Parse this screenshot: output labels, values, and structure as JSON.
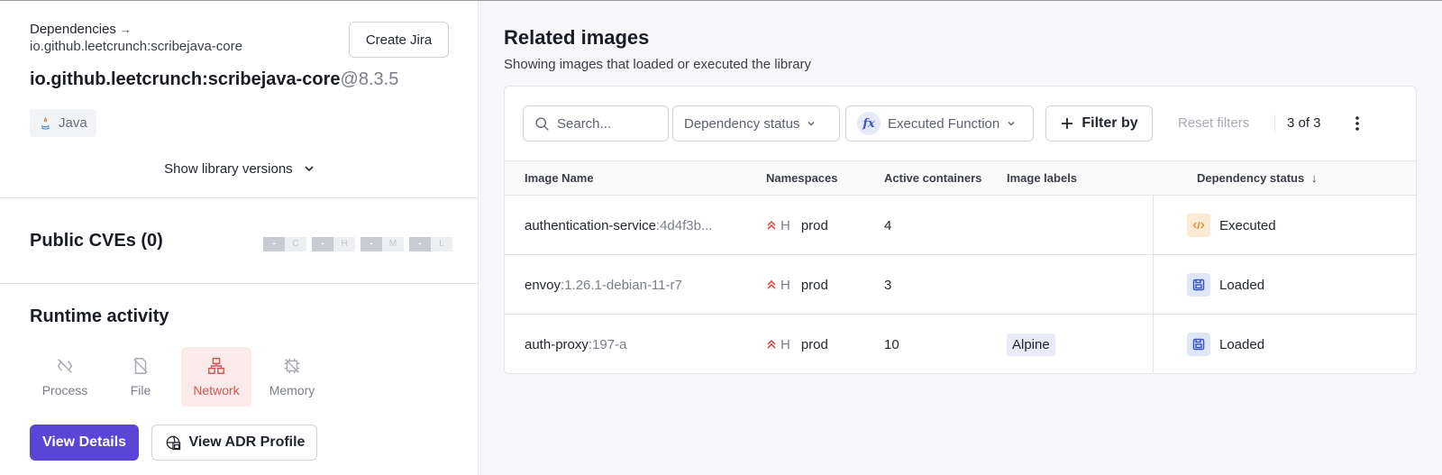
{
  "left": {
    "breadcrumb": "Dependencies",
    "breadcrumb_arrow": "→",
    "breadcrumb_sub": "io.github.leetcrunch:scribejava-core",
    "create_jira_label": "Create Jira",
    "library_name": "io.github.leetcrunch:scribejava-core",
    "library_version": "@8.3.5",
    "language": "Java",
    "show_versions_label": "Show library versions",
    "cves_title": "Public CVEs (0)",
    "severity": [
      {
        "count": "-",
        "letter": "C"
      },
      {
        "count": "-",
        "letter": "H"
      },
      {
        "count": "-",
        "letter": "M"
      },
      {
        "count": "-",
        "letter": "L"
      }
    ],
    "runtime_title": "Runtime activity",
    "runtime_tabs": [
      "Process",
      "File",
      "Network",
      "Memory"
    ],
    "active_runtime_tab": "Network",
    "view_details_label": "View Details",
    "view_adr_label": "View ADR Profile"
  },
  "right": {
    "title": "Related images",
    "subtitle": "Showing images that loaded or executed the library",
    "search_placeholder": "Search...",
    "dependency_status_filter": "Dependency status",
    "executed_function_filter": "Executed Function",
    "fx_label": "fx",
    "filter_by_label": "Filter by",
    "reset_filters_label": "Reset filters",
    "count_label": "3 of 3",
    "columns": [
      "Image Name",
      "Namespaces",
      "Active containers",
      "Image labels",
      "Dependency status"
    ],
    "sort_arrow": "↓",
    "rows": [
      {
        "name": "authentication-service",
        "tag": ":4d4f3b...",
        "ns_level": "H",
        "namespace": "prod",
        "active": "4",
        "label": "",
        "status": "Executed",
        "status_kind": "executed"
      },
      {
        "name": "envoy",
        "tag": ":1.26.1-debian-11-r7",
        "ns_level": "H",
        "namespace": "prod",
        "active": "3",
        "label": "",
        "status": "Loaded",
        "status_kind": "loaded"
      },
      {
        "name": "auth-proxy",
        "tag": ":197-a",
        "ns_level": "H",
        "namespace": "prod",
        "active": "10",
        "label": "Alpine",
        "status": "Loaded",
        "status_kind": "loaded"
      }
    ]
  },
  "colors": {
    "primary": "#5a45d6",
    "network_active": "#d9534f",
    "executed_bg": "#fbead4",
    "loaded_bg": "#dfe6f6",
    "high_severity": "#d9534f"
  }
}
